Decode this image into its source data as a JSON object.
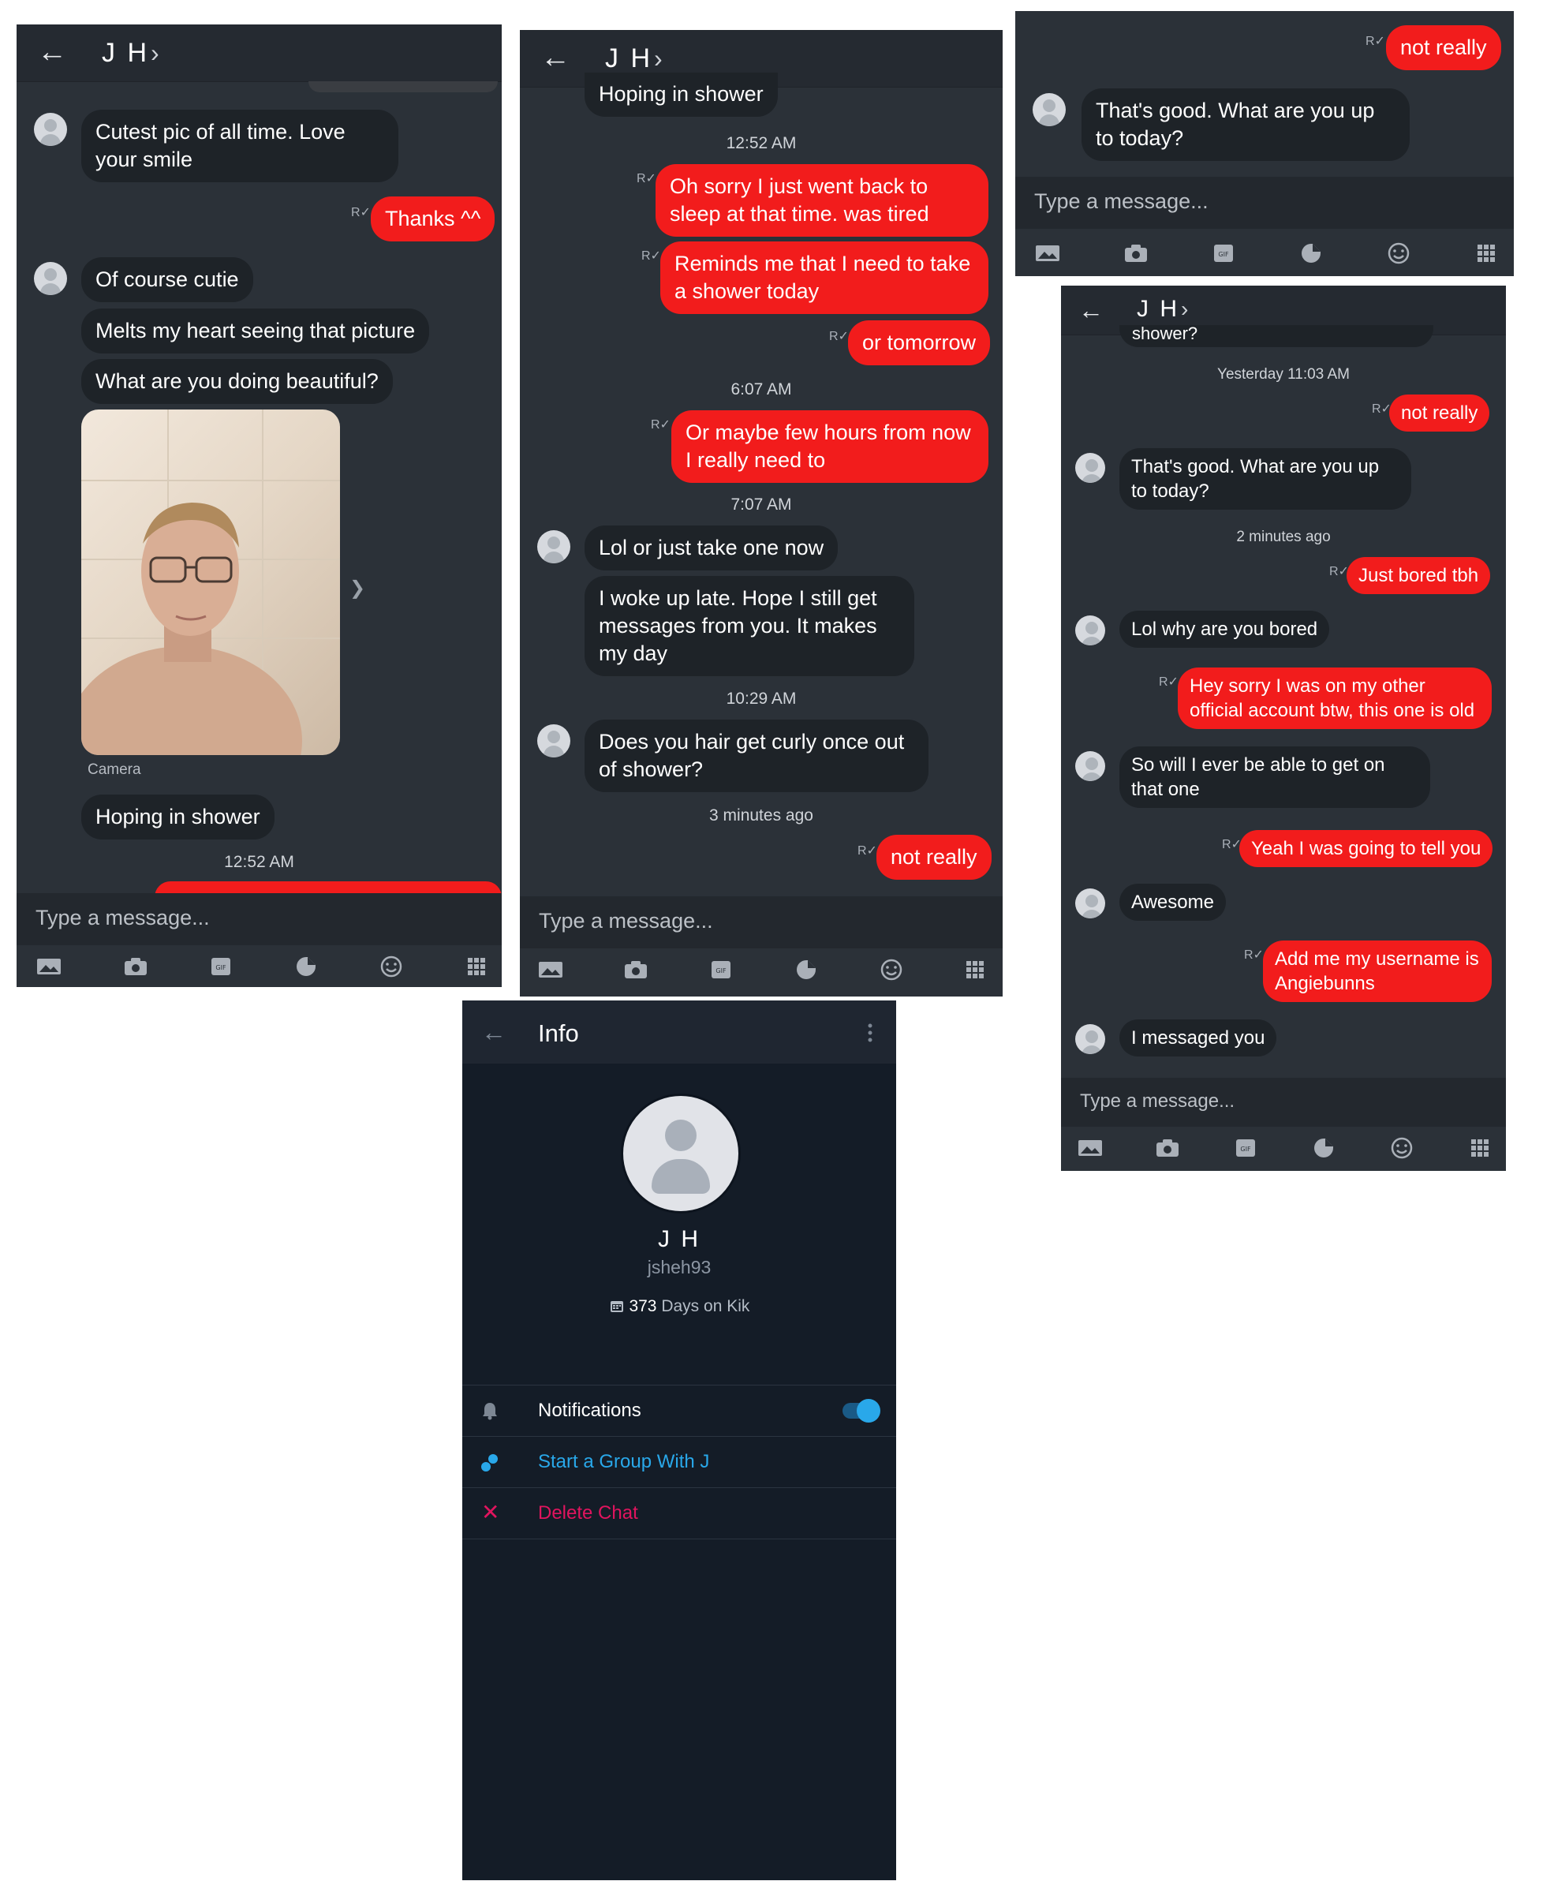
{
  "colors": {
    "incoming_bubble": "#1e2328",
    "outgoing_bubble": "#f21c1c",
    "panel_bg": "#2b3138",
    "accent_blue": "#29a8ea",
    "delete_pink": "#e0145e"
  },
  "chat": {
    "contact_name": "J H",
    "chevron": "›",
    "back_icon": "arrow-left-icon",
    "input_placeholder": "Type a message...",
    "receipt_glyph": "R✓",
    "toolbar_icons": [
      "gallery-icon",
      "camera-icon",
      "gif-icon",
      "sticker-icon",
      "emoji-icon",
      "apps-grid-icon"
    ],
    "gif_label": "GIF"
  },
  "panel1": {
    "msg_cutest": "Cutest pic of all time. Love your smile",
    "msg_thanks": "Thanks ^^",
    "msg_of_course": "Of course cutie",
    "msg_melts": "Melts my heart seeing that picture",
    "msg_what_doing": "What are you doing beautiful?",
    "photo_caption": "Camera",
    "msg_hoping": "Hoping in shower",
    "time_1252": "12:52 AM"
  },
  "panel2": {
    "msg_hoping": "Hoping in shower",
    "time_1252": "12:52 AM",
    "msg_oh_sorry": "Oh sorry I just went back to sleep at that time. was tired",
    "msg_reminds": "Reminds me that I need to take a shower today",
    "msg_or_tomorrow": "or tomorrow",
    "time_607": "6:07 AM",
    "msg_or_maybe": "Or maybe few hours from now I really need to",
    "time_707": "7:07 AM",
    "msg_lol_take": "Lol or just take one now",
    "msg_woke_up": "I woke up late. Hope I still get messages from you. It makes my day",
    "time_1029": "10:29 AM",
    "msg_curly": "Does you hair get curly once out of shower?",
    "time_3min": "3 minutes ago",
    "msg_not_really": "not really"
  },
  "panel3": {
    "msg_not_really": "not really",
    "msg_thats_good": "That's good. What are you up to today?"
  },
  "panel4": {
    "top_clip": "shower?",
    "time_yesterday": "Yesterday 11:03 AM",
    "msg_not_really": "not really",
    "msg_thats_good": "That's good. What are you up to today?",
    "time_2min": "2 minutes ago",
    "msg_bored_tbh": "Just bored tbh",
    "msg_why_bored": "Lol why are you bored",
    "msg_hey_sorry": "Hey sorry I was on my other official account btw, this one is old",
    "msg_so_will": "So will I ever be able to get on that one",
    "msg_yeah": "Yeah I was going to tell you",
    "msg_awesome": "Awesome",
    "msg_add_me": "Add me my username is Angiebunns",
    "msg_messaged": "I messaged you"
  },
  "info": {
    "title": "Info",
    "name": "J H",
    "username": "jsheh93",
    "days_count": "373",
    "days_suffix": " Days on Kik",
    "notifications_label": "Notifications",
    "notifications_on": true,
    "start_group_label": "Start a Group With J",
    "delete_chat_label": "Delete Chat"
  }
}
